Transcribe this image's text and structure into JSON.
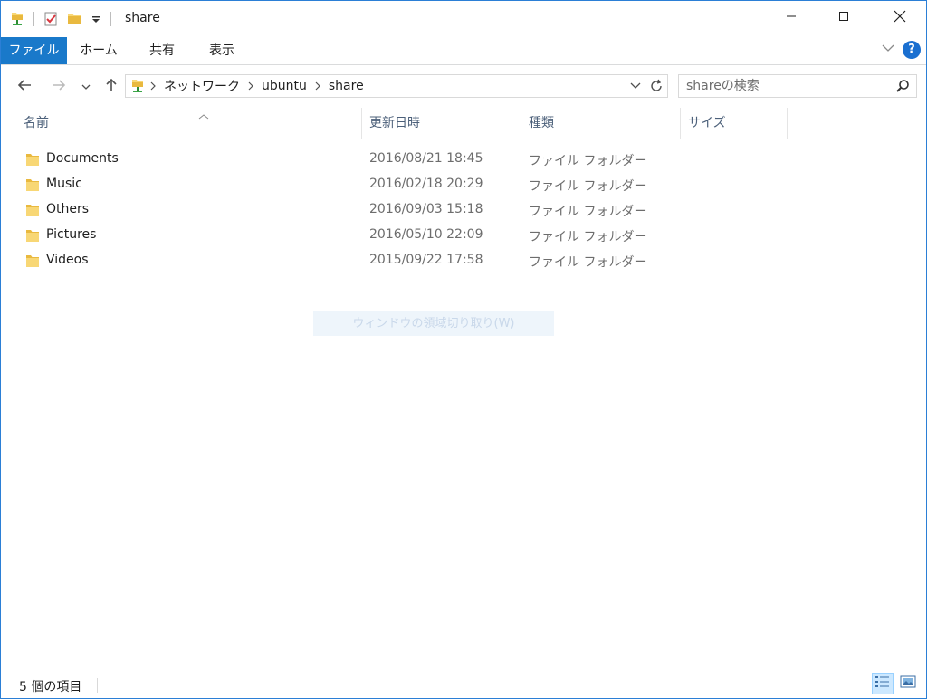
{
  "window": {
    "title": "share"
  },
  "ribbon": {
    "tabs": [
      "ファイル",
      "ホーム",
      "共有",
      "表示"
    ]
  },
  "address": {
    "crumbs": [
      "ネットワーク",
      "ubuntu",
      "share"
    ]
  },
  "search": {
    "placeholder": "shareの検索"
  },
  "columns": {
    "name": "名前",
    "date": "更新日時",
    "type": "種類",
    "size": "サイズ"
  },
  "items": [
    {
      "name": "Documents",
      "date": "2016/08/21 18:45",
      "type": "ファイル フォルダー"
    },
    {
      "name": "Music",
      "date": "2016/02/18 20:29",
      "type": "ファイル フォルダー"
    },
    {
      "name": "Others",
      "date": "2016/09/03 15:18",
      "type": "ファイル フォルダー"
    },
    {
      "name": "Pictures",
      "date": "2016/05/10 22:09",
      "type": "ファイル フォルダー"
    },
    {
      "name": "Videos",
      "date": "2015/09/22 17:58",
      "type": "ファイル フォルダー"
    }
  ],
  "overlay": {
    "text": "ウィンドウの領域切り取り(W)"
  },
  "status": {
    "count": "5 個の項目"
  },
  "colors": {
    "accent": "#1979ca",
    "folder": "#f8d775",
    "help": "#1a6fd0"
  },
  "icons": [
    "network-share-icon",
    "properties-icon",
    "new-folder-icon",
    "customize-qat-icon",
    "minimize-icon",
    "maximize-icon",
    "close-icon",
    "chevron-down-icon",
    "help-icon",
    "back-arrow-icon",
    "forward-arrow-icon",
    "recent-locations-icon",
    "up-arrow-icon",
    "refresh-icon",
    "search-icon",
    "folder-icon",
    "details-view-icon",
    "large-icons-view-icon"
  ]
}
